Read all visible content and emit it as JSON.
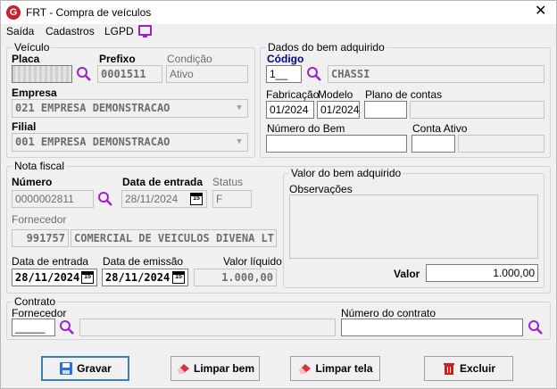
{
  "window": {
    "title": "FRT - Compra de veículos",
    "app_icon": "G",
    "close_glyph": "✕"
  },
  "menu": [
    "Saída",
    "Cadastros",
    "LGPD"
  ],
  "veiculo": {
    "legend": "Veículo",
    "placa_label": "Placa",
    "placa_value": "",
    "prefixo_label": "Prefixo",
    "prefixo_value": "0001511",
    "condicao_label": "Condição",
    "condicao_value": "Ativo",
    "empresa_label": "Empresa",
    "empresa_value": "021 EMPRESA DEMONSTRACAO",
    "filial_label": "Filial",
    "filial_value": "001 EMPRESA DEMONSTRACAO"
  },
  "bem": {
    "legend": "Dados do bem adquirido",
    "codigo_label": "Código",
    "codigo_value": "1__",
    "codigo_desc": "CHASSI",
    "fabricacao_label": "Fabricação",
    "fabricacao_value": "01/2024",
    "modelo_label": "Modelo",
    "modelo_value": "01/2024",
    "plano_label": "Plano de contas",
    "numero_bem_label": "Número do Bem",
    "conta_ativo_label": "Conta Ativo"
  },
  "nota": {
    "legend": "Nota fiscal",
    "numero_label": "Número",
    "numero_value": "0000002811",
    "data_entrada_label": "Data de entrada",
    "data_entrada_value": "28/11/2024",
    "status_label": "Status",
    "status_value": "F",
    "fornecedor_label": "Fornecedor",
    "fornecedor_code": "991757",
    "fornecedor_name": "COMERCIAL DE VEICULOS DIVENA LT",
    "data_entrada2_label": "Data de entrada",
    "data_entrada2_value": "28/11/2024",
    "data_emissao_label": "Data de emissão",
    "data_emissao_value": "28/11/2024",
    "valor_liquido_label": "Valor líquido",
    "valor_liquido_value": "1.000,00"
  },
  "valor_bem": {
    "legend": "Valor do bem adquirido",
    "obs_label": "Observações",
    "valor_label": "Valor",
    "valor_value": "1.000,00"
  },
  "contrato": {
    "legend": "Contrato",
    "fornecedor_label": "Fornecedor",
    "fornecedor_value": "_____",
    "numero_label": "Número do contrato"
  },
  "buttons": {
    "gravar": "Gravar",
    "limpar_bem": "Limpar bem",
    "limpar_tela": "Limpar tela",
    "excluir": "Excluir"
  },
  "colors": {
    "accent": "#a020d0",
    "label_blue": "#00008b",
    "focus_border": "#3c7fb1",
    "danger": "#d01c1c"
  }
}
